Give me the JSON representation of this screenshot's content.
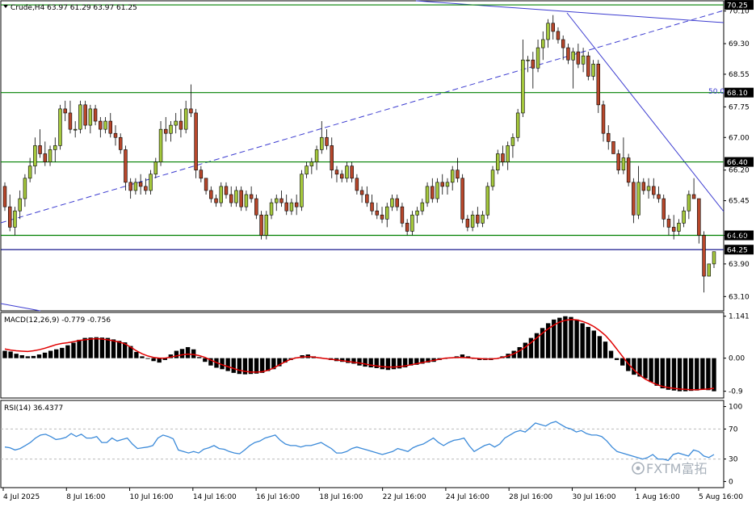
{
  "chart_data": [
    {
      "type": "candlestick",
      "title": "Crude,H4  63.97 61.29 63.97 61.25",
      "y_ticks": [
        "70.10",
        "69.30",
        "68.55",
        "67.75",
        "67.00",
        "66.20",
        "65.45",
        "64.60",
        "63.90",
        "63.10"
      ],
      "ylim": [
        62.75,
        70.35
      ],
      "x_ticks": [
        "4 Jul 2025",
        "8 Jul 16:00",
        "10 Jul 16:00",
        "14 Jul 16:00",
        "16 Jul 16:00",
        "18 Jul 16:00",
        "22 Jul 16:00",
        "24 Jul 16:00",
        "28 Jul 16:00",
        "30 Jul 16:00",
        "1 Aug 16:00",
        "5 Aug 16:00"
      ],
      "horizontal_levels": [
        {
          "value": 70.25,
          "label": "70.25",
          "color": "#008000"
        },
        {
          "value": 68.1,
          "label": "68.10",
          "color": "#008000"
        },
        {
          "value": 66.4,
          "label": "66.40",
          "color": "#008000"
        },
        {
          "value": 64.6,
          "label": "64.60",
          "color": "#008000"
        },
        {
          "value": 64.25,
          "label": "64.25",
          "color": "#000080"
        }
      ],
      "fib_label": "50.0",
      "up_color": "#a5c83c",
      "down_color": "#b8472b",
      "candles": [
        [
          65.8,
          65.9,
          65.2,
          65.3
        ],
        [
          65.3,
          65.6,
          64.7,
          64.8
        ],
        [
          64.8,
          65.3,
          64.6,
          65.2
        ],
        [
          65.2,
          65.7,
          65.0,
          65.5
        ],
        [
          65.5,
          66.1,
          65.3,
          66.0
        ],
        [
          66.0,
          66.5,
          65.9,
          66.3
        ],
        [
          66.3,
          67.0,
          66.1,
          66.8
        ],
        [
          66.8,
          67.2,
          66.5,
          66.6
        ],
        [
          66.6,
          66.9,
          66.3,
          66.4
        ],
        [
          66.4,
          66.8,
          66.3,
          66.7
        ],
        [
          66.7,
          67.0,
          66.4,
          66.8
        ],
        [
          66.8,
          67.8,
          66.7,
          67.7
        ],
        [
          67.7,
          67.9,
          67.4,
          67.6
        ],
        [
          67.6,
          67.9,
          67.1,
          67.2
        ],
        [
          67.2,
          67.4,
          67.0,
          67.2
        ],
        [
          67.2,
          67.9,
          67.1,
          67.8
        ],
        [
          67.8,
          67.9,
          67.2,
          67.3
        ],
        [
          67.3,
          67.8,
          67.1,
          67.7
        ],
        [
          67.7,
          67.8,
          67.3,
          67.4
        ],
        [
          67.4,
          67.5,
          67.0,
          67.2
        ],
        [
          67.2,
          67.5,
          67.1,
          67.4
        ],
        [
          67.4,
          67.6,
          67.0,
          67.1
        ],
        [
          67.1,
          67.3,
          66.8,
          67.0
        ],
        [
          67.0,
          67.1,
          66.6,
          66.7
        ],
        [
          66.7,
          66.8,
          65.7,
          65.9
        ],
        [
          65.9,
          66.0,
          65.5,
          65.7
        ],
        [
          65.7,
          66.0,
          65.6,
          65.9
        ],
        [
          65.9,
          66.1,
          65.6,
          65.8
        ],
        [
          65.8,
          66.0,
          65.6,
          65.7
        ],
        [
          65.7,
          66.2,
          65.6,
          66.1
        ],
        [
          66.1,
          66.5,
          66.0,
          66.4
        ],
        [
          66.4,
          67.4,
          66.3,
          67.2
        ],
        [
          67.2,
          67.5,
          66.9,
          67.1
        ],
        [
          67.1,
          67.4,
          66.9,
          67.3
        ],
        [
          67.3,
          67.6,
          67.1,
          67.4
        ],
        [
          67.4,
          67.7,
          67.0,
          67.2
        ],
        [
          67.2,
          67.9,
          67.1,
          67.7
        ],
        [
          67.7,
          68.3,
          67.5,
          67.6
        ],
        [
          67.6,
          67.7,
          66.0,
          66.2
        ],
        [
          66.2,
          66.3,
          65.9,
          66.0
        ],
        [
          66.0,
          66.0,
          65.6,
          65.7
        ],
        [
          65.7,
          65.8,
          65.4,
          65.5
        ],
        [
          65.5,
          65.6,
          65.3,
          65.4
        ],
        [
          65.4,
          65.9,
          65.3,
          65.8
        ],
        [
          65.8,
          65.9,
          65.5,
          65.6
        ],
        [
          65.6,
          65.8,
          65.3,
          65.4
        ],
        [
          65.4,
          65.8,
          65.3,
          65.7
        ],
        [
          65.7,
          65.8,
          65.2,
          65.3
        ],
        [
          65.3,
          65.7,
          65.2,
          65.6
        ],
        [
          65.6,
          65.8,
          65.4,
          65.5
        ],
        [
          65.5,
          65.6,
          65.0,
          65.1
        ],
        [
          65.1,
          65.2,
          64.5,
          64.6
        ],
        [
          64.6,
          65.2,
          64.5,
          65.1
        ],
        [
          65.1,
          65.5,
          65.0,
          65.4
        ],
        [
          65.4,
          65.6,
          65.2,
          65.5
        ],
        [
          65.5,
          65.7,
          65.3,
          65.4
        ],
        [
          65.4,
          65.6,
          65.1,
          65.2
        ],
        [
          65.2,
          65.5,
          65.1,
          65.4
        ],
        [
          65.4,
          65.6,
          65.1,
          65.3
        ],
        [
          65.3,
          66.2,
          65.2,
          66.1
        ],
        [
          66.1,
          66.4,
          66.0,
          66.3
        ],
        [
          66.3,
          66.5,
          66.1,
          66.4
        ],
        [
          66.4,
          66.8,
          66.2,
          66.7
        ],
        [
          66.7,
          67.4,
          66.6,
          67.0
        ],
        [
          67.0,
          67.2,
          66.7,
          66.8
        ],
        [
          66.8,
          67.0,
          66.0,
          66.2
        ],
        [
          66.2,
          66.3,
          65.9,
          66.1
        ],
        [
          66.1,
          66.2,
          65.9,
          66.0
        ],
        [
          66.0,
          66.4,
          65.9,
          66.3
        ],
        [
          66.3,
          66.4,
          65.9,
          66.0
        ],
        [
          66.0,
          66.1,
          65.6,
          65.7
        ],
        [
          65.7,
          65.8,
          65.4,
          65.6
        ],
        [
          65.6,
          65.8,
          65.3,
          65.4
        ],
        [
          65.4,
          65.6,
          65.1,
          65.2
        ],
        [
          65.2,
          65.4,
          65.0,
          65.1
        ],
        [
          65.1,
          65.3,
          64.9,
          65.0
        ],
        [
          65.0,
          65.4,
          64.8,
          65.3
        ],
        [
          65.3,
          65.6,
          65.2,
          65.5
        ],
        [
          65.5,
          65.6,
          65.2,
          65.3
        ],
        [
          65.3,
          65.4,
          64.8,
          64.9
        ],
        [
          64.9,
          65.0,
          64.6,
          64.7
        ],
        [
          64.7,
          65.2,
          64.6,
          65.1
        ],
        [
          65.1,
          65.3,
          64.9,
          65.2
        ],
        [
          65.2,
          65.5,
          65.1,
          65.4
        ],
        [
          65.4,
          65.9,
          65.3,
          65.8
        ],
        [
          65.8,
          66.0,
          65.4,
          65.5
        ],
        [
          65.5,
          66.0,
          65.4,
          65.9
        ],
        [
          65.9,
          66.1,
          65.6,
          65.8
        ],
        [
          65.8,
          66.0,
          65.6,
          65.9
        ],
        [
          65.9,
          66.3,
          65.7,
          66.2
        ],
        [
          66.2,
          66.5,
          65.9,
          66.0
        ],
        [
          66.0,
          66.1,
          64.9,
          65.0
        ],
        [
          65.0,
          65.1,
          64.7,
          64.8
        ],
        [
          64.8,
          65.2,
          64.7,
          65.1
        ],
        [
          65.1,
          65.3,
          64.8,
          64.9
        ],
        [
          64.9,
          65.2,
          64.8,
          65.1
        ],
        [
          65.1,
          65.9,
          65.0,
          65.8
        ],
        [
          65.8,
          66.3,
          65.7,
          66.2
        ],
        [
          66.2,
          66.7,
          66.1,
          66.6
        ],
        [
          66.6,
          66.8,
          66.3,
          66.4
        ],
        [
          66.4,
          66.9,
          66.2,
          66.8
        ],
        [
          66.8,
          67.1,
          66.5,
          67.0
        ],
        [
          67.0,
          67.7,
          66.9,
          67.6
        ],
        [
          67.6,
          69.4,
          67.5,
          68.9
        ],
        [
          68.9,
          69.0,
          68.6,
          68.9
        ],
        [
          68.9,
          69.1,
          68.2,
          68.7
        ],
        [
          68.7,
          69.4,
          68.6,
          69.2
        ],
        [
          69.2,
          69.6,
          68.9,
          69.4
        ],
        [
          69.4,
          69.9,
          69.2,
          69.8
        ],
        [
          69.8,
          70.0,
          69.4,
          69.6
        ],
        [
          69.6,
          69.7,
          69.3,
          69.4
        ],
        [
          69.4,
          69.5,
          68.9,
          69.2
        ],
        [
          69.2,
          69.3,
          68.8,
          68.9
        ],
        [
          68.9,
          69.2,
          68.2,
          69.1
        ],
        [
          69.1,
          69.3,
          68.7,
          68.8
        ],
        [
          68.8,
          69.2,
          68.6,
          69.0
        ],
        [
          69.0,
          69.1,
          68.4,
          68.5
        ],
        [
          68.5,
          68.9,
          68.4,
          68.8
        ],
        [
          68.8,
          68.9,
          67.6,
          67.8
        ],
        [
          67.8,
          67.9,
          66.9,
          67.1
        ],
        [
          67.1,
          67.3,
          66.7,
          66.9
        ],
        [
          66.9,
          66.9,
          66.6,
          66.6
        ],
        [
          66.6,
          66.7,
          66.1,
          66.2
        ],
        [
          66.2,
          67.0,
          66.1,
          66.5
        ],
        [
          66.5,
          66.6,
          65.8,
          65.9
        ],
        [
          65.9,
          66.0,
          64.9,
          65.1
        ],
        [
          65.1,
          66.3,
          65.0,
          65.9
        ],
        [
          65.9,
          66.0,
          65.6,
          65.7
        ],
        [
          65.7,
          66.0,
          65.5,
          65.8
        ],
        [
          65.8,
          66.0,
          65.5,
          65.6
        ],
        [
          65.6,
          65.8,
          65.4,
          65.5
        ],
        [
          65.5,
          65.6,
          64.8,
          65.0
        ],
        [
          65.0,
          65.1,
          64.6,
          64.8
        ],
        [
          64.8,
          65.1,
          64.5,
          64.7
        ],
        [
          64.7,
          65.0,
          64.6,
          64.9
        ],
        [
          64.9,
          65.3,
          64.8,
          65.2
        ],
        [
          65.2,
          65.7,
          65.0,
          65.6
        ],
        [
          65.6,
          66.0,
          65.5,
          65.5
        ],
        [
          65.5,
          65.5,
          64.4,
          64.6
        ],
        [
          64.6,
          64.7,
          63.2,
          63.6
        ],
        [
          63.6,
          63.9,
          63.6,
          63.9
        ],
        [
          63.9,
          64.2,
          63.8,
          64.2
        ]
      ]
    },
    {
      "type": "macd",
      "title": "MACD(12,26,9) -0.779 -0.756",
      "y_ticks": [
        "1.141",
        "0.00",
        "-0.9"
      ],
      "ylim": [
        -1.04,
        1.2
      ],
      "histogram_color": "#000000",
      "signal_color": "#e00000",
      "histogram": [
        0.2,
        0.18,
        0.12,
        0.08,
        0.05,
        0.06,
        0.1,
        0.15,
        0.2,
        0.24,
        0.28,
        0.35,
        0.42,
        0.5,
        0.55,
        0.56,
        0.57,
        0.56,
        0.55,
        0.51,
        0.47,
        0.43,
        0.33,
        0.17,
        0.05,
        -0.02,
        -0.08,
        -0.12,
        -0.05,
        0.1,
        0.2,
        0.25,
        0.3,
        0.24,
        0.03,
        -0.1,
        -0.2,
        -0.26,
        -0.3,
        -0.35,
        -0.4,
        -0.43,
        -0.44,
        -0.43,
        -0.42,
        -0.4,
        -0.35,
        -0.3,
        -0.22,
        -0.12,
        -0.05,
        0.02,
        0.08,
        0.1,
        0.05,
        0.02,
        -0.02,
        -0.05,
        -0.08,
        -0.1,
        -0.13,
        -0.15,
        -0.2,
        -0.23,
        -0.25,
        -0.27,
        -0.3,
        -0.32,
        -0.3,
        -0.28,
        -0.25,
        -0.2,
        -0.18,
        -0.15,
        -0.12,
        -0.1,
        -0.05,
        -0.02,
        0.02,
        0.05,
        0.1,
        0.05,
        -0.02,
        -0.05,
        -0.05,
        -0.05,
        -0.02,
        0.05,
        0.12,
        0.2,
        0.3,
        0.42,
        0.55,
        0.68,
        0.82,
        0.95,
        1.05,
        1.1,
        1.14,
        1.12,
        1.05,
        0.95,
        0.85,
        0.75,
        0.6,
        0.45,
        0.2,
        -0.05,
        -0.2,
        -0.35,
        -0.45,
        -0.5,
        -0.55,
        -0.65,
        -0.75,
        -0.82,
        -0.86,
        -0.88,
        -0.9,
        -0.9,
        -0.89,
        -0.88,
        -0.86,
        -0.87,
        -0.9
      ],
      "signal": [
        0.25,
        0.22,
        0.2,
        0.19,
        0.18,
        0.2,
        0.23,
        0.27,
        0.32,
        0.37,
        0.4,
        0.42,
        0.45,
        0.48,
        0.5,
        0.52,
        0.53,
        0.52,
        0.5,
        0.47,
        0.44,
        0.39,
        0.3,
        0.2,
        0.12,
        0.06,
        0.02,
        0.0,
        0.0,
        0.03,
        0.06,
        0.09,
        0.11,
        0.1,
        0.07,
        0.02,
        -0.05,
        -0.12,
        -0.18,
        -0.23,
        -0.28,
        -0.33,
        -0.36,
        -0.38,
        -0.38,
        -0.37,
        -0.33,
        -0.27,
        -0.18,
        -0.1,
        -0.03,
        0.01,
        0.03,
        0.04,
        0.03,
        0.01,
        -0.01,
        -0.03,
        -0.05,
        -0.07,
        -0.09,
        -0.11,
        -0.13,
        -0.16,
        -0.19,
        -0.21,
        -0.23,
        -0.24,
        -0.24,
        -0.23,
        -0.21,
        -0.18,
        -0.15,
        -0.12,
        -0.09,
        -0.06,
        -0.03,
        0.0,
        0.01,
        0.02,
        0.02,
        0.01,
        0.0,
        -0.01,
        -0.02,
        -0.02,
        -0.01,
        0.02,
        0.06,
        0.12,
        0.2,
        0.3,
        0.42,
        0.55,
        0.68,
        0.8,
        0.9,
        0.98,
        1.03,
        1.05,
        1.04,
        1.0,
        0.94,
        0.86,
        0.75,
        0.62,
        0.45,
        0.25,
        0.05,
        -0.15,
        -0.32,
        -0.46,
        -0.57,
        -0.65,
        -0.72,
        -0.77,
        -0.8,
        -0.82,
        -0.84,
        -0.85,
        -0.86,
        -0.86,
        -0.85,
        -0.84,
        -0.82
      ]
    },
    {
      "type": "line",
      "title": "RSI(14) 36.4377",
      "y_ticks": [
        "100",
        "70",
        "30",
        "0"
      ],
      "ylim": [
        -6,
        106
      ],
      "levels": [
        70,
        30
      ],
      "line_color": "#3b8ad9",
      "values": [
        46,
        45,
        42,
        44,
        48,
        52,
        58,
        62,
        63,
        60,
        56,
        57,
        59,
        64,
        60,
        63,
        58,
        58,
        60,
        52,
        52,
        58,
        54,
        56,
        58,
        50,
        44,
        45,
        46,
        48,
        58,
        62,
        60,
        57,
        42,
        40,
        38,
        40,
        38,
        43,
        45,
        48,
        44,
        43,
        40,
        38,
        37,
        42,
        48,
        52,
        54,
        58,
        60,
        62,
        55,
        50,
        48,
        48,
        46,
        48,
        48,
        50,
        52,
        48,
        44,
        38,
        38,
        40,
        44,
        46,
        44,
        42,
        40,
        38,
        36,
        38,
        40,
        44,
        42,
        40,
        45,
        48,
        50,
        54,
        58,
        52,
        48,
        52,
        55,
        56,
        58,
        48,
        40,
        44,
        48,
        50,
        46,
        50,
        58,
        62,
        66,
        68,
        66,
        72,
        78,
        76,
        74,
        78,
        80,
        76,
        72,
        70,
        66,
        68,
        64,
        62,
        62,
        60,
        54,
        46,
        40,
        38,
        36,
        34,
        32,
        30,
        32,
        36,
        30,
        30,
        28,
        36,
        38,
        36,
        34,
        42,
        40,
        34,
        32,
        36
      ]
    }
  ],
  "watermark_text": "FXTM富拓"
}
